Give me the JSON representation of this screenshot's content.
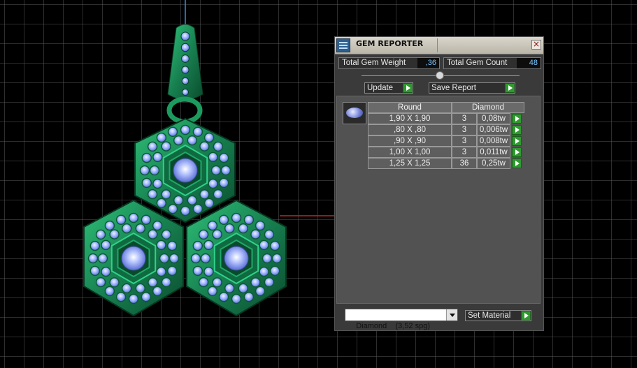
{
  "panel": {
    "title": "GEM REPORTER",
    "close_glyph": "×",
    "total_weight_label": "Total Gem Weight",
    "total_weight_value": ",36",
    "total_count_label": "Total Gem Count",
    "total_count_value": "48",
    "update_label": "Update",
    "save_report_label": "Save Report",
    "table": {
      "headers": [
        "Round",
        "Diamond"
      ],
      "rows": [
        {
          "size": "1,90 X 1,90",
          "count": "3",
          "weight": "0,08tw"
        },
        {
          "size": ",80 X ,80",
          "count": "3",
          "weight": "0,006tw"
        },
        {
          "size": ",90 X ,90",
          "count": "3",
          "weight": "0,008tw"
        },
        {
          "size": "1,00 X 1,00",
          "count": "3",
          "weight": "0,011tw"
        },
        {
          "size": "1,25 X 1,25",
          "count": "36",
          "weight": "0,25tw"
        }
      ]
    },
    "material_select_value": "Diamond    (3,52 spg)",
    "set_material_label": "Set Material"
  },
  "icons": {
    "app": "gem-reporter-app-icon",
    "close": "close-icon",
    "go": "play-arrow-icon",
    "dropdown": "chevron-down-icon",
    "gem": "round-gem-icon"
  },
  "colors": {
    "viewport_bg": "#000000",
    "grid": "#5a5a5a",
    "pendant_green": "#1c8a55",
    "gem_blue": "#8fa6ff",
    "value_text": "#7ec8ff",
    "go_button": "#2e9a2e"
  }
}
